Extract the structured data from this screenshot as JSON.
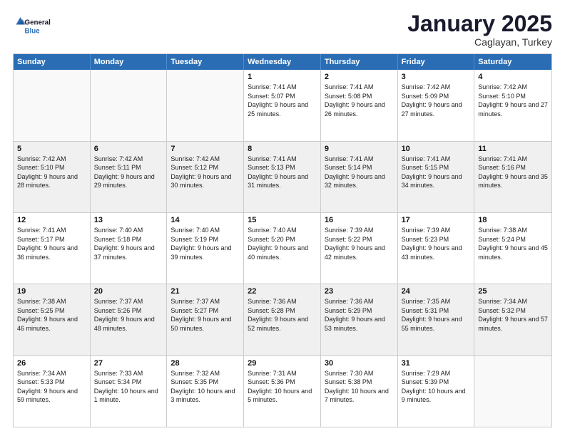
{
  "logo": {
    "line1": "General",
    "line2": "Blue"
  },
  "title": "January 2025",
  "subtitle": "Caglayan, Turkey",
  "header_days": [
    "Sunday",
    "Monday",
    "Tuesday",
    "Wednesday",
    "Thursday",
    "Friday",
    "Saturday"
  ],
  "rows": [
    [
      {
        "day": "",
        "text": ""
      },
      {
        "day": "",
        "text": ""
      },
      {
        "day": "",
        "text": ""
      },
      {
        "day": "1",
        "text": "Sunrise: 7:41 AM\nSunset: 5:07 PM\nDaylight: 9 hours and 25 minutes."
      },
      {
        "day": "2",
        "text": "Sunrise: 7:41 AM\nSunset: 5:08 PM\nDaylight: 9 hours and 26 minutes."
      },
      {
        "day": "3",
        "text": "Sunrise: 7:42 AM\nSunset: 5:09 PM\nDaylight: 9 hours and 27 minutes."
      },
      {
        "day": "4",
        "text": "Sunrise: 7:42 AM\nSunset: 5:10 PM\nDaylight: 9 hours and 27 minutes."
      }
    ],
    [
      {
        "day": "5",
        "text": "Sunrise: 7:42 AM\nSunset: 5:10 PM\nDaylight: 9 hours and 28 minutes."
      },
      {
        "day": "6",
        "text": "Sunrise: 7:42 AM\nSunset: 5:11 PM\nDaylight: 9 hours and 29 minutes."
      },
      {
        "day": "7",
        "text": "Sunrise: 7:42 AM\nSunset: 5:12 PM\nDaylight: 9 hours and 30 minutes."
      },
      {
        "day": "8",
        "text": "Sunrise: 7:41 AM\nSunset: 5:13 PM\nDaylight: 9 hours and 31 minutes."
      },
      {
        "day": "9",
        "text": "Sunrise: 7:41 AM\nSunset: 5:14 PM\nDaylight: 9 hours and 32 minutes."
      },
      {
        "day": "10",
        "text": "Sunrise: 7:41 AM\nSunset: 5:15 PM\nDaylight: 9 hours and 34 minutes."
      },
      {
        "day": "11",
        "text": "Sunrise: 7:41 AM\nSunset: 5:16 PM\nDaylight: 9 hours and 35 minutes."
      }
    ],
    [
      {
        "day": "12",
        "text": "Sunrise: 7:41 AM\nSunset: 5:17 PM\nDaylight: 9 hours and 36 minutes."
      },
      {
        "day": "13",
        "text": "Sunrise: 7:40 AM\nSunset: 5:18 PM\nDaylight: 9 hours and 37 minutes."
      },
      {
        "day": "14",
        "text": "Sunrise: 7:40 AM\nSunset: 5:19 PM\nDaylight: 9 hours and 39 minutes."
      },
      {
        "day": "15",
        "text": "Sunrise: 7:40 AM\nSunset: 5:20 PM\nDaylight: 9 hours and 40 minutes."
      },
      {
        "day": "16",
        "text": "Sunrise: 7:39 AM\nSunset: 5:22 PM\nDaylight: 9 hours and 42 minutes."
      },
      {
        "day": "17",
        "text": "Sunrise: 7:39 AM\nSunset: 5:23 PM\nDaylight: 9 hours and 43 minutes."
      },
      {
        "day": "18",
        "text": "Sunrise: 7:38 AM\nSunset: 5:24 PM\nDaylight: 9 hours and 45 minutes."
      }
    ],
    [
      {
        "day": "19",
        "text": "Sunrise: 7:38 AM\nSunset: 5:25 PM\nDaylight: 9 hours and 46 minutes."
      },
      {
        "day": "20",
        "text": "Sunrise: 7:37 AM\nSunset: 5:26 PM\nDaylight: 9 hours and 48 minutes."
      },
      {
        "day": "21",
        "text": "Sunrise: 7:37 AM\nSunset: 5:27 PM\nDaylight: 9 hours and 50 minutes."
      },
      {
        "day": "22",
        "text": "Sunrise: 7:36 AM\nSunset: 5:28 PM\nDaylight: 9 hours and 52 minutes."
      },
      {
        "day": "23",
        "text": "Sunrise: 7:36 AM\nSunset: 5:29 PM\nDaylight: 9 hours and 53 minutes."
      },
      {
        "day": "24",
        "text": "Sunrise: 7:35 AM\nSunset: 5:31 PM\nDaylight: 9 hours and 55 minutes."
      },
      {
        "day": "25",
        "text": "Sunrise: 7:34 AM\nSunset: 5:32 PM\nDaylight: 9 hours and 57 minutes."
      }
    ],
    [
      {
        "day": "26",
        "text": "Sunrise: 7:34 AM\nSunset: 5:33 PM\nDaylight: 9 hours and 59 minutes."
      },
      {
        "day": "27",
        "text": "Sunrise: 7:33 AM\nSunset: 5:34 PM\nDaylight: 10 hours and 1 minute."
      },
      {
        "day": "28",
        "text": "Sunrise: 7:32 AM\nSunset: 5:35 PM\nDaylight: 10 hours and 3 minutes."
      },
      {
        "day": "29",
        "text": "Sunrise: 7:31 AM\nSunset: 5:36 PM\nDaylight: 10 hours and 5 minutes."
      },
      {
        "day": "30",
        "text": "Sunrise: 7:30 AM\nSunset: 5:38 PM\nDaylight: 10 hours and 7 minutes."
      },
      {
        "day": "31",
        "text": "Sunrise: 7:29 AM\nSunset: 5:39 PM\nDaylight: 10 hours and 9 minutes."
      },
      {
        "day": "",
        "text": ""
      }
    ]
  ]
}
